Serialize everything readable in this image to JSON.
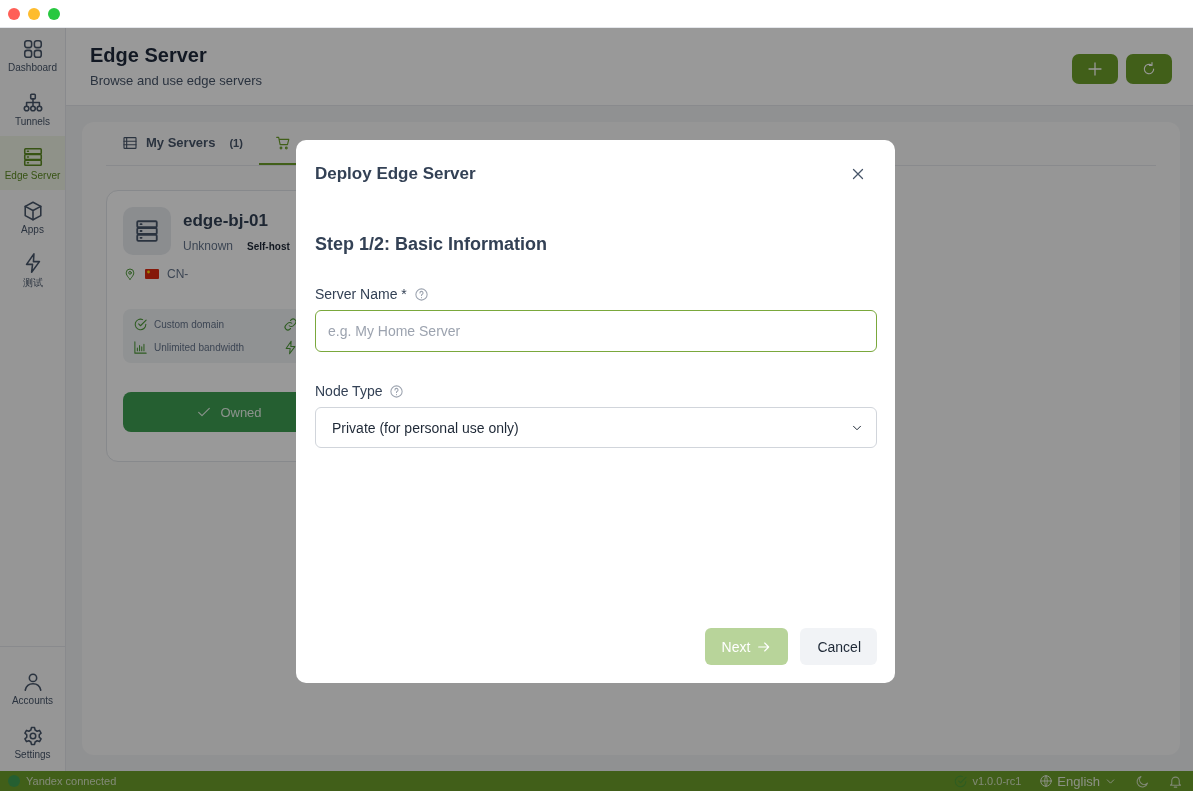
{
  "sidebar": {
    "items": [
      {
        "label": "Dashboard",
        "kind": "grid",
        "selected": false
      },
      {
        "label": "Tunnels",
        "kind": "tree",
        "selected": false
      },
      {
        "label": "Edge Server",
        "kind": "server",
        "selected": true
      },
      {
        "label": "Apps",
        "kind": "cube",
        "selected": false
      },
      {
        "label": "测试",
        "kind": "bolt",
        "selected": false
      }
    ],
    "bottom_items": [
      {
        "label": "Accounts",
        "kind": "user",
        "selected": false
      },
      {
        "label": "Settings",
        "kind": "gear",
        "selected": false
      }
    ]
  },
  "header": {
    "title": "Edge Server",
    "subtitle": "Browse and use edge servers",
    "actions": [
      {
        "kind": "add"
      },
      {
        "kind": "refresh"
      }
    ]
  },
  "tabs": [
    {
      "label": "My Servers",
      "count": "(1)",
      "kind": "list",
      "selected": false
    },
    {
      "kind": "cart",
      "selected": true
    }
  ],
  "server_card": {
    "name": "edge-bj-01",
    "status": "Unknown",
    "badge": "Self-host",
    "location": "CN-",
    "features": [
      {
        "kind": "check",
        "label": "Custom domain"
      },
      {
        "kind": "link"
      },
      {
        "kind": "chart",
        "label": "Unlimited bandwidth"
      },
      {
        "kind": "bolt"
      }
    ],
    "button": "Owned"
  },
  "modal": {
    "title": "Deploy Edge Server",
    "step": "Step 1/2: Basic Information",
    "fields": [
      {
        "kind": "text",
        "label": "Server Name *",
        "placeholder": "e.g. My Home Server"
      },
      {
        "kind": "select",
        "label": "Node Type",
        "value": "Private (for personal use only)"
      }
    ],
    "buttons": [
      {
        "kind": "primary",
        "label": "Next",
        "disabled": true
      },
      {
        "kind": "secondary",
        "label": "Cancel"
      }
    ]
  },
  "status_bar": {
    "connection": "Yandex connected",
    "connected": true,
    "version": "v1.0.0-rc1",
    "language": "English"
  }
}
